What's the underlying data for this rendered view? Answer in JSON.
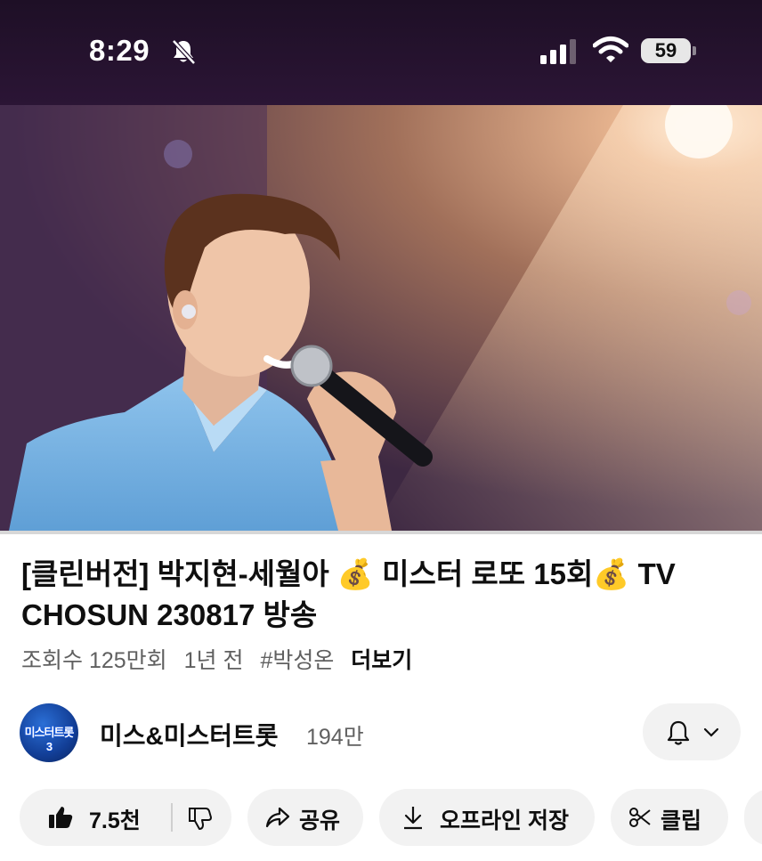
{
  "status_bar": {
    "time": "8:29",
    "battery": "59",
    "icons": [
      "bell-off-icon",
      "cellular-signal-icon",
      "wifi-icon",
      "battery-icon"
    ]
  },
  "video": {
    "progress": 0.0
  },
  "title": {
    "prefix": "[클린버전]  박지현-세월아 ",
    "middle": " 미스터 로또 ",
    "episode": "15회",
    "suffix": " TV CHOSUN 230817 ",
    "suffix_end": "방송",
    "emoji": "💰"
  },
  "meta": {
    "views": "조회수 125만회",
    "age": "1년 전",
    "hashtag": "#박성온",
    "more": "더보기"
  },
  "channel": {
    "avatar_text": "미스터트롯3",
    "name": "미스&미스터트롯",
    "subscribers": "194만"
  },
  "actions": {
    "likes": "7.5천",
    "share": "공유",
    "download": "오프라인 저장",
    "clip": "클립"
  },
  "colors": {
    "progress": "#ff0033",
    "button_bg": "#f2f2f2",
    "meta_text": "#606060"
  }
}
